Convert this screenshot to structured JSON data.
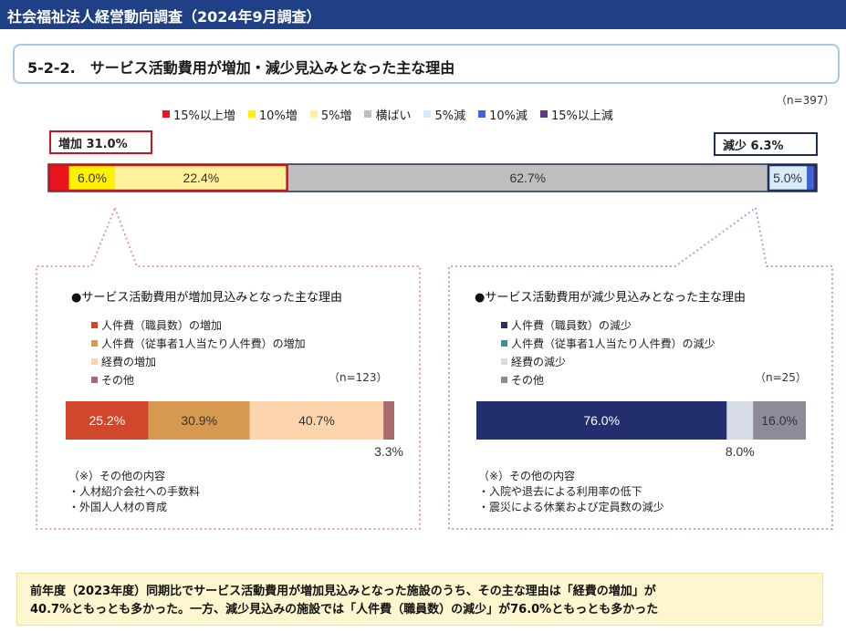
{
  "header": {
    "title": "社会福祉法人経営動向調査（2024年9月調査）"
  },
  "section": {
    "title": "5-2-2.　サービス活動費用が増加・減少見込みとなった主な理由"
  },
  "colors": {
    "header_bg": "#1f3f86",
    "inc15": "#e8141e",
    "inc10": "#fff200",
    "inc5": "#fff29a",
    "flat": "#bfbfbf",
    "dec5": "#d9ebf7",
    "dec10": "#3a63d9",
    "dec15": "#5b3a8c",
    "inc_highlight": "#c8141e",
    "dec_highlight": "#1c2e5a",
    "left_r1": "#d1472c",
    "left_r2": "#d59a4f",
    "left_r3": "#fdd5ad",
    "left_r4": "#a86a6a",
    "right_r1": "#232e6e",
    "right_r2": "#3b8f9e",
    "right_r3": "#d6dbe6",
    "right_r4": "#8f8a99"
  },
  "legend": [
    {
      "label": "15%以上増",
      "color": "#e8141e"
    },
    {
      "label": "10%増",
      "color": "#fff200"
    },
    {
      "label": "5%増",
      "color": "#fff29a"
    },
    {
      "label": "横ばい",
      "color": "#bfbfbf"
    },
    {
      "label": "5%減",
      "color": "#d9ebf7"
    },
    {
      "label": "10%減",
      "color": "#3a63d9"
    },
    {
      "label": "15%以上減",
      "color": "#5b3a8c"
    }
  ],
  "summary": {
    "n": "（n=397）",
    "increase_label": "増加 31.0%",
    "decrease_label": "減少 6.3%"
  },
  "chart_data": [
    {
      "type": "bar",
      "orientation": "horizontal-stacked",
      "n": 397,
      "series": [
        {
          "name": "15%以上増",
          "value": 2.7,
          "label": ""
        },
        {
          "name": "10%増",
          "value": 6.0,
          "label": "6.0%"
        },
        {
          "name": "5%増",
          "value": 22.4,
          "label": "22.4%"
        },
        {
          "name": "横ばい",
          "value": 62.7,
          "label": "62.7%"
        },
        {
          "name": "5%減",
          "value": 5.0,
          "label": "5.0%"
        },
        {
          "name": "10%減",
          "value": 0.8,
          "label": ""
        },
        {
          "name": "15%以上減",
          "value": 0.5,
          "label": ""
        }
      ]
    },
    {
      "type": "bar",
      "orientation": "horizontal-stacked",
      "title": "●サービス活動費用が増加見込みとなった主な理由",
      "n": 123,
      "series": [
        {
          "name": "人件費（職員数）の増加",
          "value": 25.2,
          "label": "25.2%"
        },
        {
          "name": "人件費（従事者1人当たり人件費）の増加",
          "value": 30.9,
          "label": "30.9%"
        },
        {
          "name": "経費の増加",
          "value": 40.7,
          "label": "40.7%"
        },
        {
          "name": "その他",
          "value": 3.3,
          "label": "3.3%"
        }
      ]
    },
    {
      "type": "bar",
      "orientation": "horizontal-stacked",
      "title": "●サービス活動費用が減少見込みとなった主な理由",
      "n": 25,
      "series": [
        {
          "name": "人件費（職員数）の減少",
          "value": 76.0,
          "label": "76.0%"
        },
        {
          "name": "人件費（従事者1人当たり人件費）の減少",
          "value": 0,
          "label": ""
        },
        {
          "name": "経費の減少",
          "value": 8.0,
          "label": "8.0%"
        },
        {
          "name": "その他",
          "value": 16.0,
          "label": "16.0%"
        }
      ]
    }
  ],
  "left_panel": {
    "title": "●サービス活動費用が増加見込みとなった主な理由",
    "legend": [
      {
        "label": "人件費（職員数）の増加",
        "color": "#d1472c"
      },
      {
        "label": "人件費（従事者1人当たり人件費）の増加",
        "color": "#d59a4f"
      },
      {
        "label": "経費の増加",
        "color": "#fdd5ad"
      },
      {
        "label": "その他",
        "color": "#a86a6a"
      }
    ],
    "n": "（n=123）",
    "notes_title": "（※）その他の内容",
    "notes": [
      "・人材紹介会社への手数料",
      "・外国人人材の育成"
    ]
  },
  "right_panel": {
    "title": "●サービス活動費用が減少見込みとなった主な理由",
    "legend": [
      {
        "label": "人件費（職員数）の減少",
        "color": "#232e6e"
      },
      {
        "label": "人件費（従事者1人当たり人件費）の減少",
        "color": "#3b8f9e"
      },
      {
        "label": "経費の減少",
        "color": "#d6dbe6"
      },
      {
        "label": "その他",
        "color": "#8f8a99"
      }
    ],
    "n": "（n=25）",
    "notes_title": "（※）その他の内容",
    "notes": [
      "・入院や退去による利用率の低下",
      "・震災による休業および定員数の減少"
    ]
  },
  "conclusion": {
    "line1": "前年度（2023年度）同期比でサービス活動費用が増加見込みとなった施設のうち、その主な理由は「経費の増加」が",
    "line2": "40.7%ともっとも多かった。一方、減少見込みの施設では「人件費（職員数）の減少」が76.0%ともっとも多かった"
  }
}
